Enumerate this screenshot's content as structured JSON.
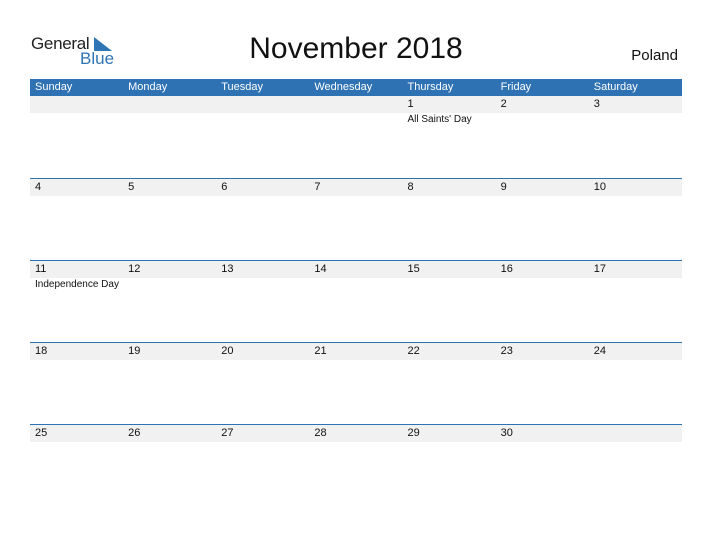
{
  "logo": {
    "text_general": "General",
    "text_blue": "Blue"
  },
  "title": "November 2018",
  "country": "Poland",
  "colors": {
    "accent": "#2e72b4",
    "row_bg": "#f1f1f1"
  },
  "weekdays": [
    "Sunday",
    "Monday",
    "Tuesday",
    "Wednesday",
    "Thursday",
    "Friday",
    "Saturday"
  ],
  "weeks": [
    {
      "days": [
        "",
        "",
        "",
        "",
        "1",
        "2",
        "3"
      ],
      "events": [
        "",
        "",
        "",
        "",
        "All Saints' Day",
        "",
        ""
      ]
    },
    {
      "days": [
        "4",
        "5",
        "6",
        "7",
        "8",
        "9",
        "10"
      ],
      "events": [
        "",
        "",
        "",
        "",
        "",
        "",
        ""
      ]
    },
    {
      "days": [
        "11",
        "12",
        "13",
        "14",
        "15",
        "16",
        "17"
      ],
      "events": [
        "Independence Day",
        "",
        "",
        "",
        "",
        "",
        ""
      ]
    },
    {
      "days": [
        "18",
        "19",
        "20",
        "21",
        "22",
        "23",
        "24"
      ],
      "events": [
        "",
        "",
        "",
        "",
        "",
        "",
        ""
      ]
    },
    {
      "days": [
        "25",
        "26",
        "27",
        "28",
        "29",
        "30",
        ""
      ],
      "events": [
        "",
        "",
        "",
        "",
        "",
        "",
        ""
      ]
    }
  ]
}
